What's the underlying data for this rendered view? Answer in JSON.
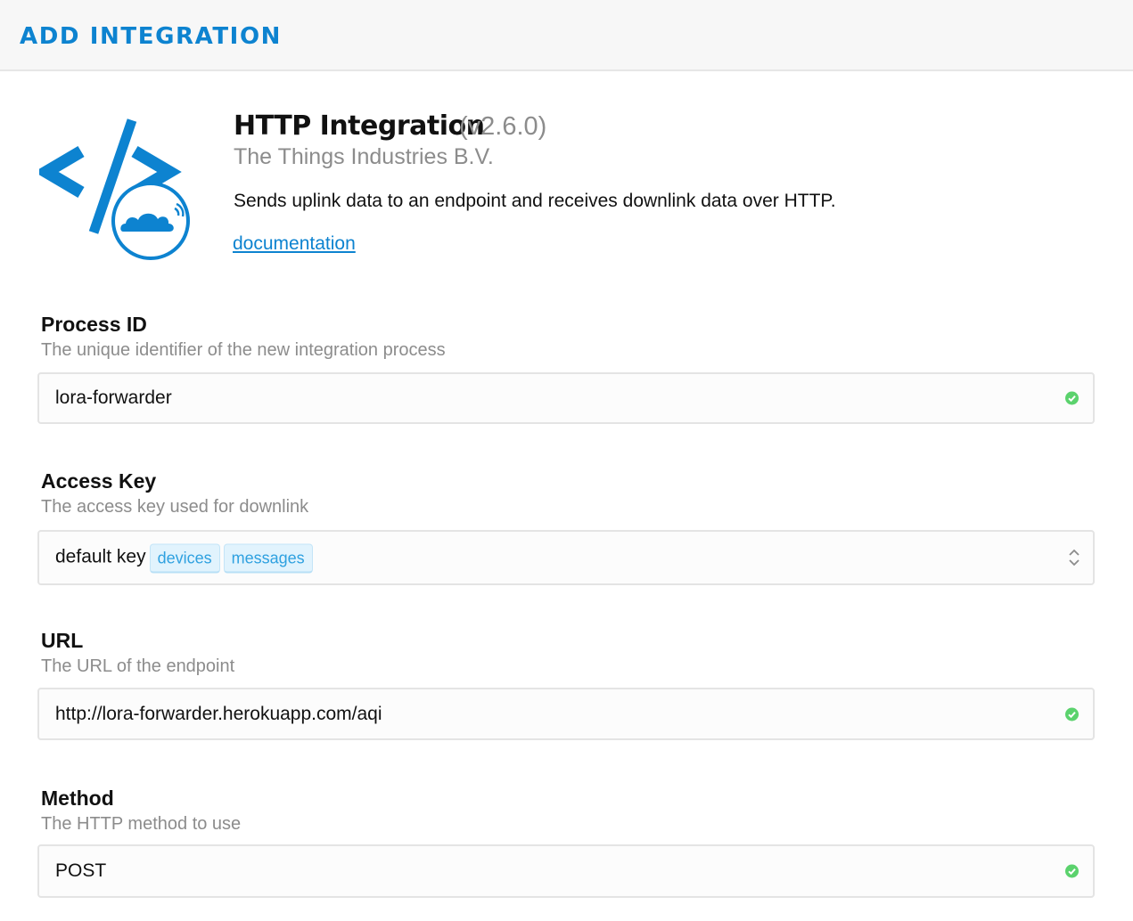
{
  "header": {
    "title": "ADD INTEGRATION"
  },
  "integration": {
    "logo_icon": "http-integration-logo-icon",
    "name": "HTTP Integration",
    "version": "(v2.6.0)",
    "vendor": "The Things Industries B.V.",
    "description": "Sends uplink data to an endpoint and receives downlink data over HTTP.",
    "doc_link": "documentation"
  },
  "fields": {
    "process_id": {
      "label": "Process ID",
      "help": "The unique identifier of the new integration process",
      "value": "lora-forwarder",
      "status_icon": "check-circle-icon"
    },
    "access_key": {
      "label": "Access Key",
      "help": "The access key used for downlink",
      "value": "default key",
      "tags": [
        "devices",
        "messages"
      ],
      "control_icon": "select-arrows-icon"
    },
    "url": {
      "label": "URL",
      "help": "The URL of the endpoint",
      "value": "http://lora-forwarder.herokuapp.com/aqi",
      "status_icon": "check-circle-icon"
    },
    "method": {
      "label": "Method",
      "help": "The HTTP method to use",
      "value": "POST",
      "status_icon": "check-circle-icon"
    }
  },
  "colors": {
    "accent": "#0d83d0",
    "valid": "#5bd26d",
    "muted": "#8c8c8c",
    "tag_bg": "#e1f3fd"
  }
}
